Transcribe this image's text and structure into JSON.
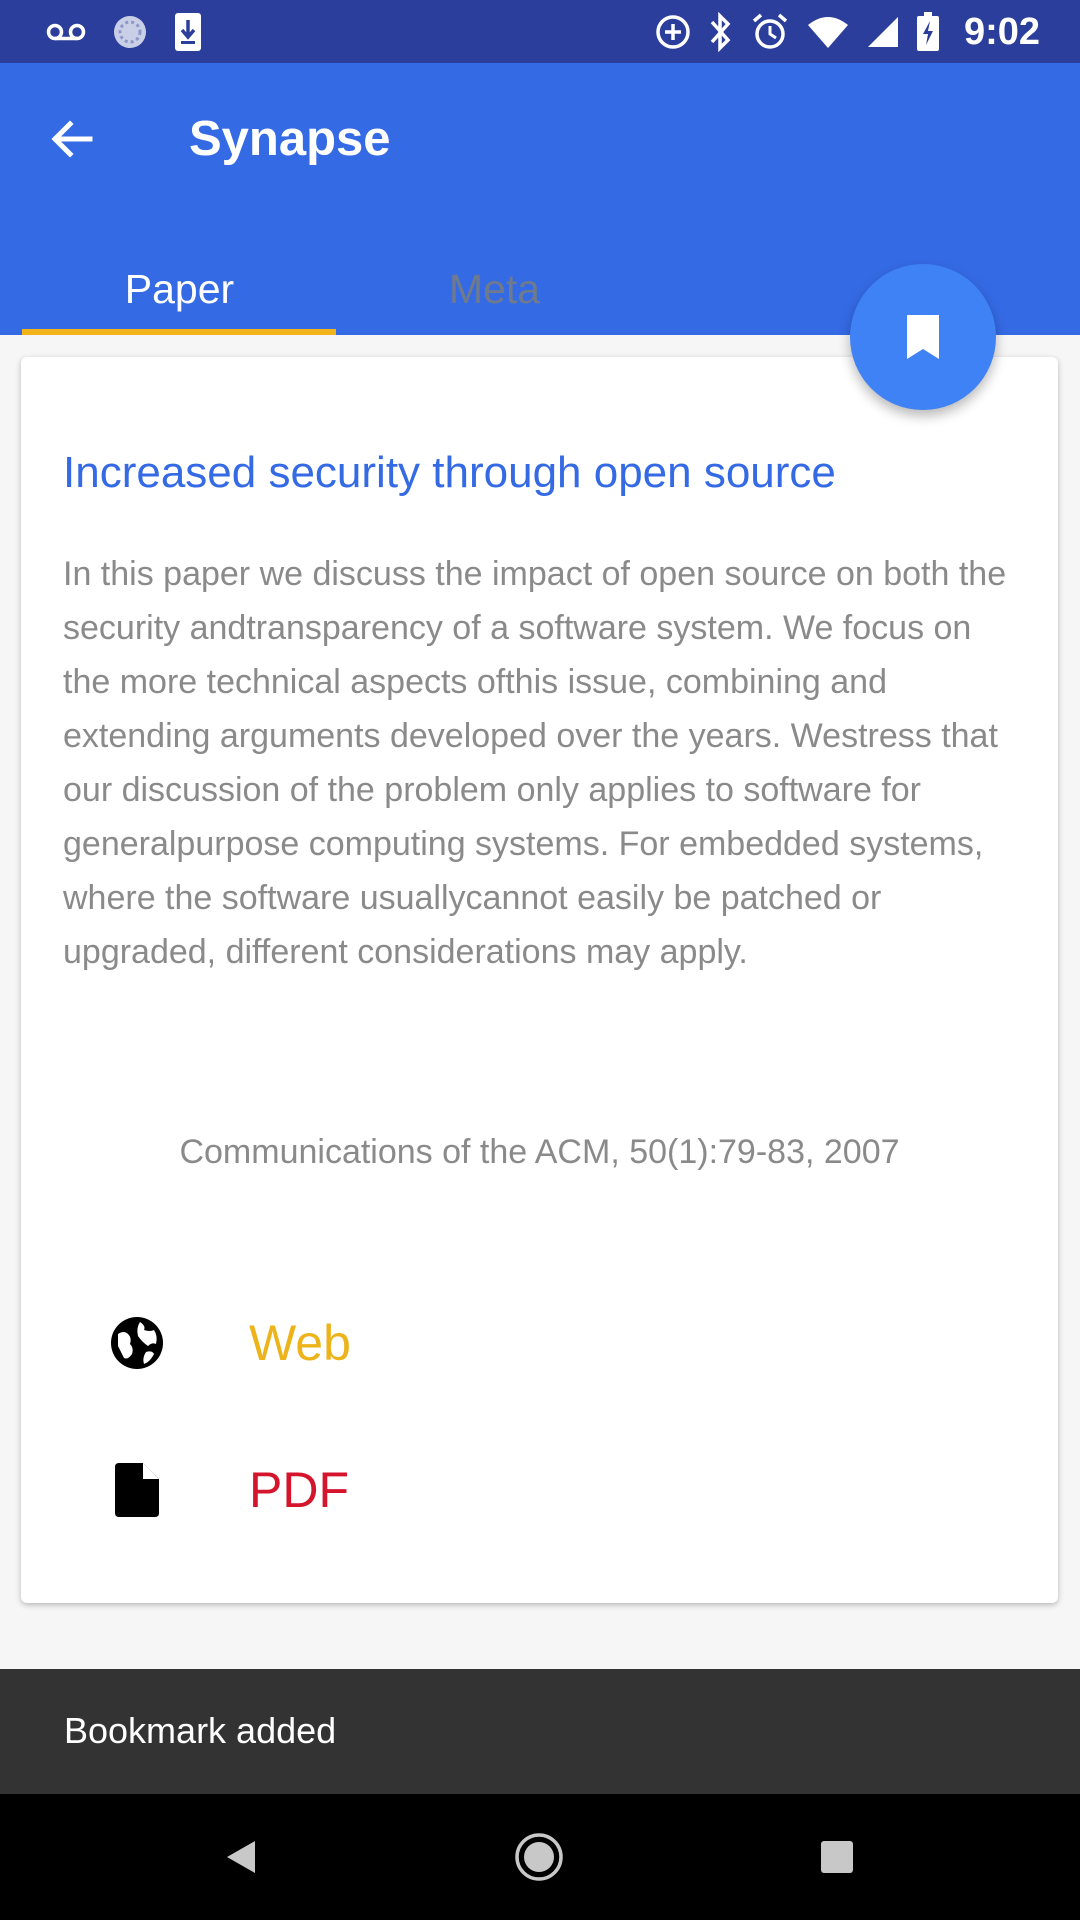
{
  "status_bar": {
    "time": "9:02",
    "left_icons": [
      "voicemail-icon",
      "sync-icon",
      "download-icon"
    ],
    "right_icons": [
      "data-saver-icon",
      "bluetooth-icon",
      "alarm-icon",
      "wifi-icon",
      "signal-icon",
      "battery-charging-icon"
    ]
  },
  "appbar": {
    "title": "Synapse",
    "back_icon": "arrow-back-icon",
    "accent_color": "#356ae5"
  },
  "tabs": [
    {
      "label": "Paper",
      "selected": true
    },
    {
      "label": "Meta",
      "selected": false
    }
  ],
  "fab": {
    "icon": "bookmark-icon",
    "color": "#3f82f5"
  },
  "paper": {
    "title": "Increased security through open source",
    "abstract": "In this paper we discuss the impact of open source on both the security andtransparency of a software system. We focus on the more technical aspects ofthis issue, combining and extending arguments developed over the years. Westress that our discussion of the problem only applies to software for generalpurpose computing systems. For embedded systems, where the software usuallycannot easily be patched or upgraded, different considerations may apply.",
    "citation": "Communications of the ACM, 50(1):79-83, 2007",
    "links": [
      {
        "label": "Web",
        "icon": "globe-icon",
        "color": "#edb31a"
      },
      {
        "label": "PDF",
        "icon": "file-icon",
        "color": "#d4152c"
      }
    ]
  },
  "snackbar": {
    "message": "Bookmark added"
  },
  "nav_bar": {
    "buttons": [
      "back-triangle-icon",
      "home-circle-icon",
      "recents-square-icon"
    ]
  }
}
